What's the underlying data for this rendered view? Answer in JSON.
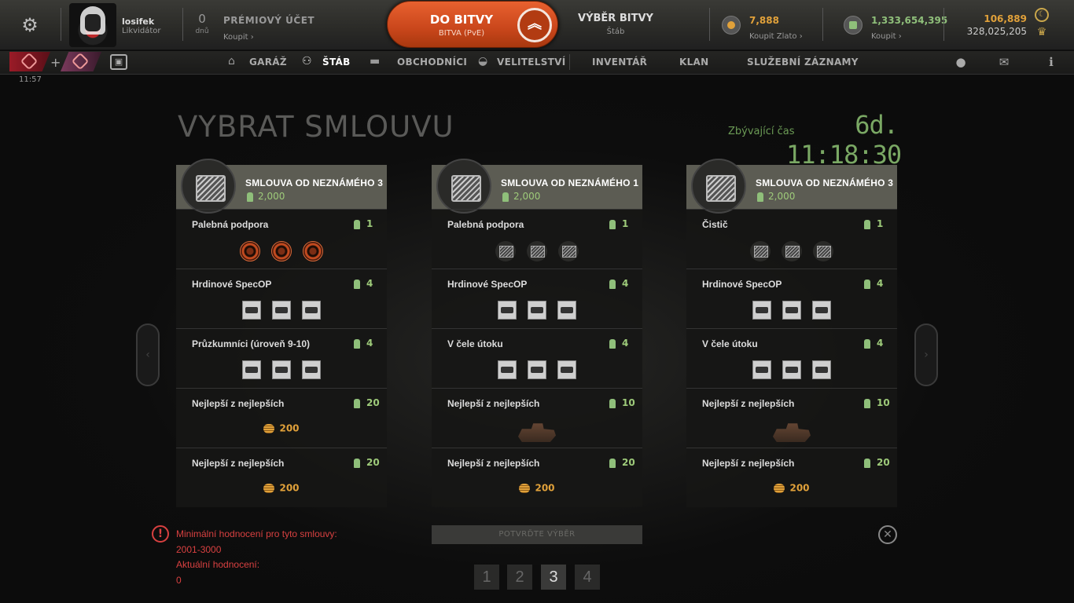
{
  "header": {
    "user": {
      "name": "losifek",
      "rank": "Likvidátor"
    },
    "premium": {
      "days": "0",
      "days_label": "dnů",
      "title": "PRÉMIOVÝ ÚČET",
      "buy": "Koupit"
    },
    "battle": {
      "title": "DO BITVY",
      "subtitle": "BITVA (PvE)"
    },
    "battle_select": {
      "title": "VÝBĚR BITVY",
      "subtitle": "Štáb"
    },
    "gold": {
      "value": "7,888",
      "buy": "Koupit Zlato"
    },
    "credits": {
      "value": "1,333,654,395",
      "buy": "Koupit"
    },
    "right": {
      "top": "106,889",
      "bottom": "328,025,205"
    },
    "colors": {
      "battle": "#d4521f",
      "gold": "#e1a13a",
      "credits": "#8fbf7a"
    }
  },
  "nav": {
    "items": [
      {
        "label": "GARÁŽ",
        "icon": "garage-icon"
      },
      {
        "label": "ŠTÁB",
        "icon": "hq-icon"
      },
      {
        "label": "OBCHODNÍCI",
        "icon": "tank-icon"
      },
      {
        "label": "VELITELSTVÍ",
        "icon": "command-icon"
      },
      {
        "label": "INVENTÁŘ"
      },
      {
        "label": "KLAN"
      },
      {
        "label": "SLUŽEBNÍ ZÁZNAMY"
      }
    ],
    "active": "ŠTÁB"
  },
  "clock": "11:57",
  "main": {
    "title": "VYBRAT SMLOUVU",
    "remaining_label": "Zbývající čas",
    "remaining_value": "6d. 11:18:30"
  },
  "contracts": [
    {
      "title": "SMLOUVA OD NEZNÁMÉHO 3",
      "price": "2,000",
      "rows": [
        {
          "label": "Palebná podpora",
          "points": "1",
          "reward": "target-icons"
        },
        {
          "label": "Hrdinové SpecOP",
          "points": "4",
          "reward": "card-icons"
        },
        {
          "label": "Průzkumníci (úroveň 9-10)",
          "points": "4",
          "reward": "card-icons"
        },
        {
          "label": "Nejlepší z nejlepších",
          "points": "20",
          "reward": "gold",
          "gold": "200"
        },
        {
          "label": "Nejlepší z nejlepších",
          "points": "20",
          "reward": "gold",
          "gold": "200"
        }
      ]
    },
    {
      "title": "SMLOUVA OD NEZNÁMÉHO 1",
      "price": "2,000",
      "rows": [
        {
          "label": "Palebná podpora",
          "points": "1",
          "reward": "chest-icons"
        },
        {
          "label": "Hrdinové SpecOP",
          "points": "4",
          "reward": "card-icons"
        },
        {
          "label": "V čele útoku",
          "points": "4",
          "reward": "card-icons"
        },
        {
          "label": "Nejlepší z nejlepších",
          "points": "10",
          "reward": "tank"
        },
        {
          "label": "Nejlepší z nejlepších",
          "points": "20",
          "reward": "gold",
          "gold": "200"
        }
      ]
    },
    {
      "title": "SMLOUVA OD NEZNÁMÉHO 3",
      "price": "2,000",
      "rows": [
        {
          "label": "Čistič",
          "points": "1",
          "reward": "chest-icons"
        },
        {
          "label": "Hrdinové SpecOP",
          "points": "4",
          "reward": "card-icons"
        },
        {
          "label": "V čele útoku",
          "points": "4",
          "reward": "card-icons"
        },
        {
          "label": "Nejlepší z nejlepších",
          "points": "10",
          "reward": "tank"
        },
        {
          "label": "Nejlepší z nejlepších",
          "points": "20",
          "reward": "gold",
          "gold": "200"
        }
      ]
    }
  ],
  "footer": {
    "warn_line1": "Minimální hodnocení pro tyto smlouvy:",
    "warn_line2": "2001-3000",
    "warn_line3": "Aktuální hodnocení:",
    "warn_line4": "0",
    "confirm": "POTVRĎTE VÝBĚR",
    "pages": [
      "1",
      "2",
      "3",
      "4"
    ],
    "active_page": "3"
  }
}
